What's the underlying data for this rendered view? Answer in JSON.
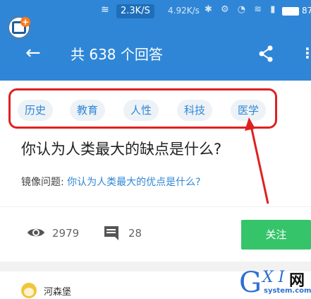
{
  "status_bar": {
    "speed": "2.3K/S",
    "speed2": "4.92K/s",
    "battery": "87"
  },
  "app_bar": {
    "title": "共 638 个回答",
    "back_icon": "back-arrow-icon",
    "share_icon": "share-icon",
    "more_icon": "more-vertical-icon"
  },
  "tags": [
    "历史",
    "教育",
    "人性",
    "科技",
    "医学"
  ],
  "question": {
    "title": "你认为人类最大的缺点是什么?",
    "mirror_label": "镜像问题:",
    "mirror_link": "你认为人类最大的优点是什么?"
  },
  "stats": {
    "views": "2979",
    "answers": "28",
    "follow_label": "关注"
  },
  "answer_preview": {
    "user_name": "河森堡"
  },
  "watermark": {
    "g": "G",
    "xi": "X I",
    "net": "网",
    "domain": "system.com"
  },
  "colors": {
    "primary": "#2f86d6",
    "follow_button": "#36c46a",
    "annotation": "#e02020"
  }
}
